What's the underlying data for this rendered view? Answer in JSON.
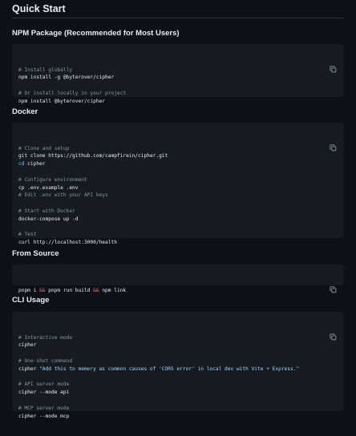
{
  "quick_start": {
    "title": "Quick Start"
  },
  "npm": {
    "title": "NPM Package (Recommended for Most Users)",
    "lines": [
      {
        "c": "# Install globally"
      },
      {
        "t": "npm install -g @byterover/cipher"
      },
      {
        "blank": true
      },
      {
        "c": "# Or install locally in your project"
      },
      {
        "t": "npm install @byterover/cipher"
      }
    ]
  },
  "docker": {
    "title": "Docker",
    "lines": [
      {
        "c": "# Clone and setup"
      },
      {
        "t": "git clone https://github.com/campfirein/cipher.git"
      },
      {
        "k": "cd",
        "t": " cipher"
      },
      {
        "blank": true
      },
      {
        "c": "# Configure environment"
      },
      {
        "t": "cp .env.example .env"
      },
      {
        "c": "# Edit .env with your API keys"
      },
      {
        "blank": true
      },
      {
        "c": "# Start with Docker"
      },
      {
        "t": "docker-compose up -d"
      },
      {
        "blank": true
      },
      {
        "c": "# Test"
      },
      {
        "t": "curl http://localhost:3000/health"
      }
    ]
  },
  "source": {
    "title": "From Source",
    "cmd_parts": [
      "pnpm i ",
      "&&",
      " pnpm run build ",
      "&&",
      " npm link"
    ]
  },
  "cli": {
    "title": "CLI Usage",
    "lines": [
      {
        "c": "# Interactive mode"
      },
      {
        "t": "cipher"
      },
      {
        "blank": true
      },
      {
        "c": "# One-shot command"
      },
      {
        "t": "cipher ",
        "s": "\"Add this to memory as common causes of 'CORS error' in local dev with Vite + Express.\""
      },
      {
        "blank": true
      },
      {
        "c": "# API server mode"
      },
      {
        "t": "cipher --mode api"
      },
      {
        "blank": true
      },
      {
        "c": "# MCP server mode"
      },
      {
        "t": "cipher --mode mcp"
      }
    ]
  },
  "icons": {
    "copy": "copy-icon"
  }
}
